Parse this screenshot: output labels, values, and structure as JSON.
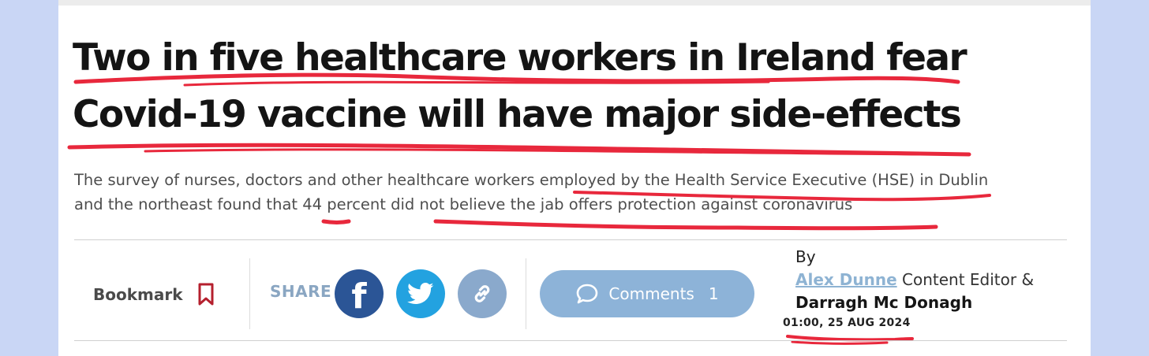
{
  "article": {
    "headline_line1": "Two in five healthcare workers in Ireland fear",
    "headline_line2": "Covid-19 vaccine will have major side-effects",
    "subhead_line1": "The survey of nurses, doctors and other healthcare workers employed by the Health Service Executive (HSE) in Dublin",
    "subhead_line2": "and the northeast found that 44 percent did not believe the jab offers protection against coronavirus"
  },
  "toolbar": {
    "bookmark_label": "Bookmark",
    "share_label": "SHARE",
    "comments_label": "Comments",
    "comments_count": "1"
  },
  "byline": {
    "by": "By",
    "author": "Alex Dunne",
    "role": "Content Editor &",
    "author2": "Darragh Mc Donagh",
    "timestamp": "01:00, 25 AUG 2024"
  },
  "icons": {
    "bookmark": "bookmark-icon",
    "facebook": "facebook-icon",
    "twitter": "twitter-icon",
    "link": "link-icon",
    "comment": "comment-bubble-icon"
  },
  "colors": {
    "page_bg": "#c9d6f5",
    "annotation": "#e8283c",
    "facebook": "#2b5596",
    "twitter": "#23a2e0",
    "link": "#8aa9cc",
    "comments_button": "#8db3d8",
    "author_link": "#8eb3d3",
    "bookmark_icon": "#b5202e"
  }
}
